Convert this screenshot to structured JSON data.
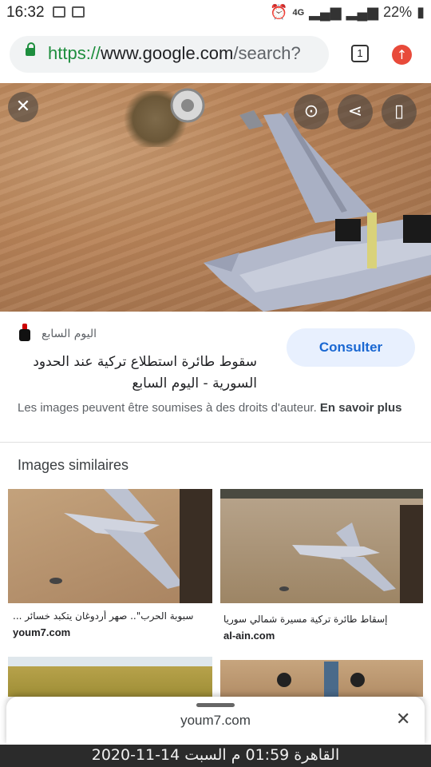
{
  "status_bar": {
    "time": "16:32",
    "network": "4G",
    "battery": "22%"
  },
  "browser": {
    "url_scheme": "https://",
    "url_host": "www.google.com",
    "url_path": "/search?",
    "tab_count": "1",
    "update_icon": "arrow-up-icon"
  },
  "viewer": {
    "source_name": "اليوم السابع",
    "title": "سقوط طائرة استطلاع تركية عند الحدود السورية - اليوم السابع",
    "visit_button": "Consulter",
    "copyright_notice": "Les images peuvent être soumises à des droits d'auteur.",
    "learn_more": "En savoir plus"
  },
  "similar": {
    "heading": "Images similaires",
    "items": [
      {
        "caption": "سبوبة الحرب\".. صهر أردوغان يتكبد خسائر ...",
        "domain": "youm7.com"
      },
      {
        "caption": "إسقاط طائرة تركية مسيرة شمالي سوريا",
        "domain": "al-ain.com"
      }
    ]
  },
  "sheet": {
    "domain": "youm7.com",
    "close_icon": "close-icon"
  },
  "overlay_footer": {
    "text": "القاهرة 01:59 م   السبت 14-11-2020"
  }
}
